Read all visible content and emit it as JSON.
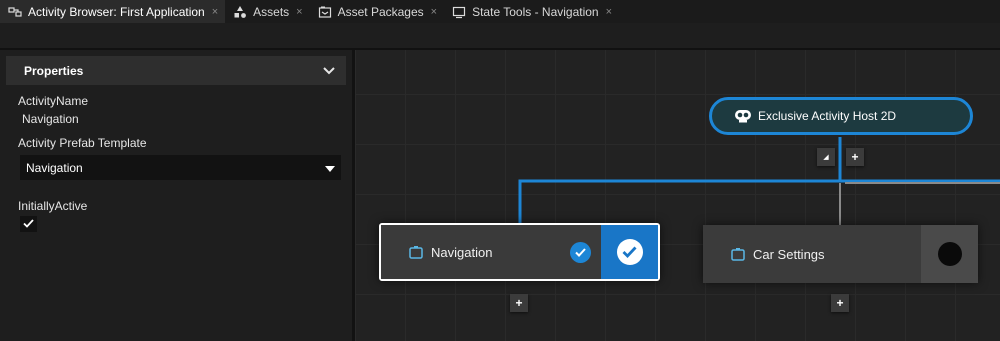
{
  "tabs": [
    {
      "label": "Activity Browser: First Application",
      "icon": "activity-browser-icon",
      "active": true,
      "closable": true
    },
    {
      "label": "Assets",
      "icon": "assets-icon",
      "active": false,
      "closable": true
    },
    {
      "label": "Asset Packages",
      "icon": "asset-packages-icon",
      "active": false,
      "closable": true
    },
    {
      "label": "State Tools - Navigation",
      "icon": "state-tools-icon",
      "active": false,
      "closable": true
    }
  ],
  "close_glyph": "×",
  "properties": {
    "title": "Properties",
    "activity_name_label": "ActivityName",
    "activity_name_value": "Navigation",
    "prefab_template_label": "Activity Prefab Template",
    "prefab_template_value": "Navigation",
    "initially_active_label": "InitiallyActive",
    "initially_active_checked": true
  },
  "graph": {
    "host_node": {
      "label": "Exclusive Activity Host 2D",
      "icon": "activity-host-icon"
    },
    "nodes": [
      {
        "label": "Navigation",
        "icon": "activity-icon",
        "selected": true,
        "active": true
      },
      {
        "label": "Car Settings",
        "icon": "activity-icon",
        "selected": false,
        "active": false
      }
    ],
    "add_glyph": "+",
    "collapse_glyph": "◢"
  },
  "colors": {
    "accent": "#1d86d6",
    "active_node_side": "#1976c7",
    "host_fill": "#1d3a40",
    "node_icon": "#5ab8e6"
  }
}
